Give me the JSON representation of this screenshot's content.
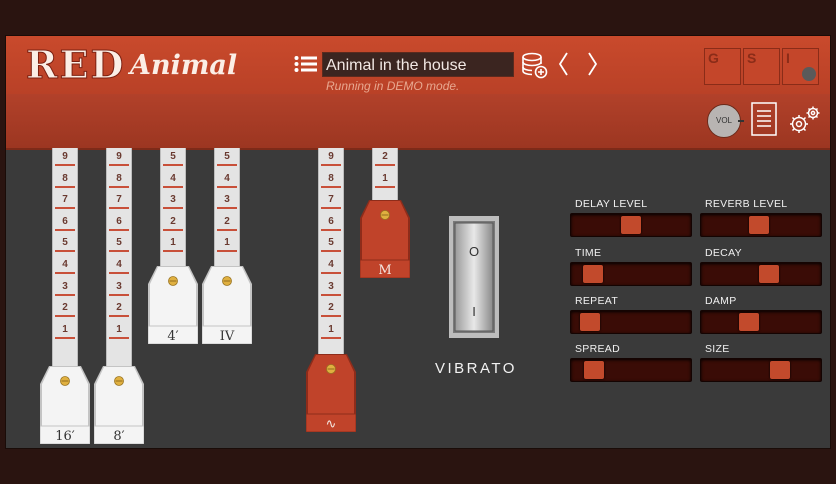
{
  "logo": {
    "word1": "RED",
    "word2": "Animal"
  },
  "preset": {
    "name": "Animal in the house",
    "status": "Running in DEMO mode."
  },
  "buttons": {
    "g": "G",
    "s": "S",
    "i": "I",
    "vol": "VOL"
  },
  "drawbars": [
    {
      "id": "16",
      "label": "16′",
      "numbers": [
        "9",
        "8",
        "7",
        "6",
        "5",
        "4",
        "3",
        "2",
        "1"
      ],
      "color": "white",
      "level": 9
    },
    {
      "id": "8",
      "label": "8′",
      "numbers": [
        "9",
        "8",
        "7",
        "6",
        "5",
        "4",
        "3",
        "2",
        "1"
      ],
      "color": "white",
      "level": 9
    },
    {
      "id": "4",
      "label": "4′",
      "numbers": [
        "5",
        "4",
        "3",
        "2",
        "1"
      ],
      "color": "white",
      "level": 5
    },
    {
      "id": "IV",
      "label": "IV",
      "numbers": [
        "5",
        "4",
        "3",
        "2",
        "1"
      ],
      "color": "white",
      "level": 5
    },
    {
      "id": "wave",
      "label": "∿",
      "numbers": [
        "9",
        "8",
        "7",
        "6",
        "5",
        "4",
        "3",
        "2",
        "1"
      ],
      "color": "red",
      "level": 9
    },
    {
      "id": "M",
      "label": "M",
      "numbers": [
        "2",
        "1"
      ],
      "color": "red",
      "level": 2
    }
  ],
  "vibrato": {
    "label": "VIBRATO",
    "on_symbol": "O",
    "off_symbol": "I"
  },
  "effects": [
    {
      "label": "DELAY LEVEL",
      "value": 0.5
    },
    {
      "label": "REVERB LEVEL",
      "value": 0.48
    },
    {
      "label": "TIME",
      "value": 0.1
    },
    {
      "label": "DECAY",
      "value": 0.58
    },
    {
      "label": "REPEAT",
      "value": 0.07
    },
    {
      "label": "DAMP",
      "value": 0.38
    },
    {
      "label": "SPREAD",
      "value": 0.11
    },
    {
      "label": "SIZE",
      "value": 0.7
    }
  ],
  "colors": {
    "header": "#c94a2c",
    "accent": "#c24a2c",
    "background": "#3a3a3a"
  }
}
